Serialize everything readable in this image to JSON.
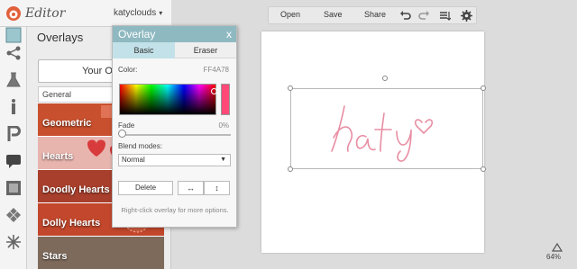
{
  "header": {
    "app_title": "Editor",
    "username": "katyclouds",
    "user_caret": "▾"
  },
  "rail": {
    "icons": [
      "robot-icon",
      "network-icon",
      "flask-icon",
      "text-icon",
      "p-icon",
      "speech-bubble-icon",
      "frame-icon",
      "texture-icon",
      "snowflake-icon"
    ]
  },
  "panel": {
    "title": "Overlays",
    "your_own_label": "Your Ow",
    "category_label": "General",
    "categories": [
      {
        "label": "Geometric",
        "color": "#c8502e"
      },
      {
        "label": "Hearts",
        "color": "#d3443d"
      },
      {
        "label": "Doodly Hearts",
        "color": "#a83f2c"
      },
      {
        "label": "Dolly Hearts",
        "color": "#c2472c"
      },
      {
        "label": "Stars",
        "color": "#7d6a5b"
      }
    ]
  },
  "toolbar": {
    "open_label": "Open",
    "save_label": "Save",
    "share_label": "Share"
  },
  "canvas": {
    "zoom_level": "64%"
  },
  "dialog": {
    "title": "Overlay",
    "close_glyph": "x",
    "tabs": [
      {
        "label": "Basic",
        "active": true
      },
      {
        "label": "Eraser",
        "active": false
      }
    ],
    "color_label": "Color:",
    "color_hex": "FF4A78",
    "fade_label": "Fade",
    "fade_value": "0%",
    "blend_label": "Blend modes:",
    "blend_value": "Normal",
    "blend_caret": "▼",
    "delete_label": "Delete",
    "flip_h_glyph": "↔",
    "flip_v_glyph": "↕",
    "hint": "Right-click overlay for more options."
  },
  "colors": {
    "accent": "#8fb9c1",
    "selected_color": "#ff4a78",
    "katy_stroke": "#e88ea3"
  }
}
